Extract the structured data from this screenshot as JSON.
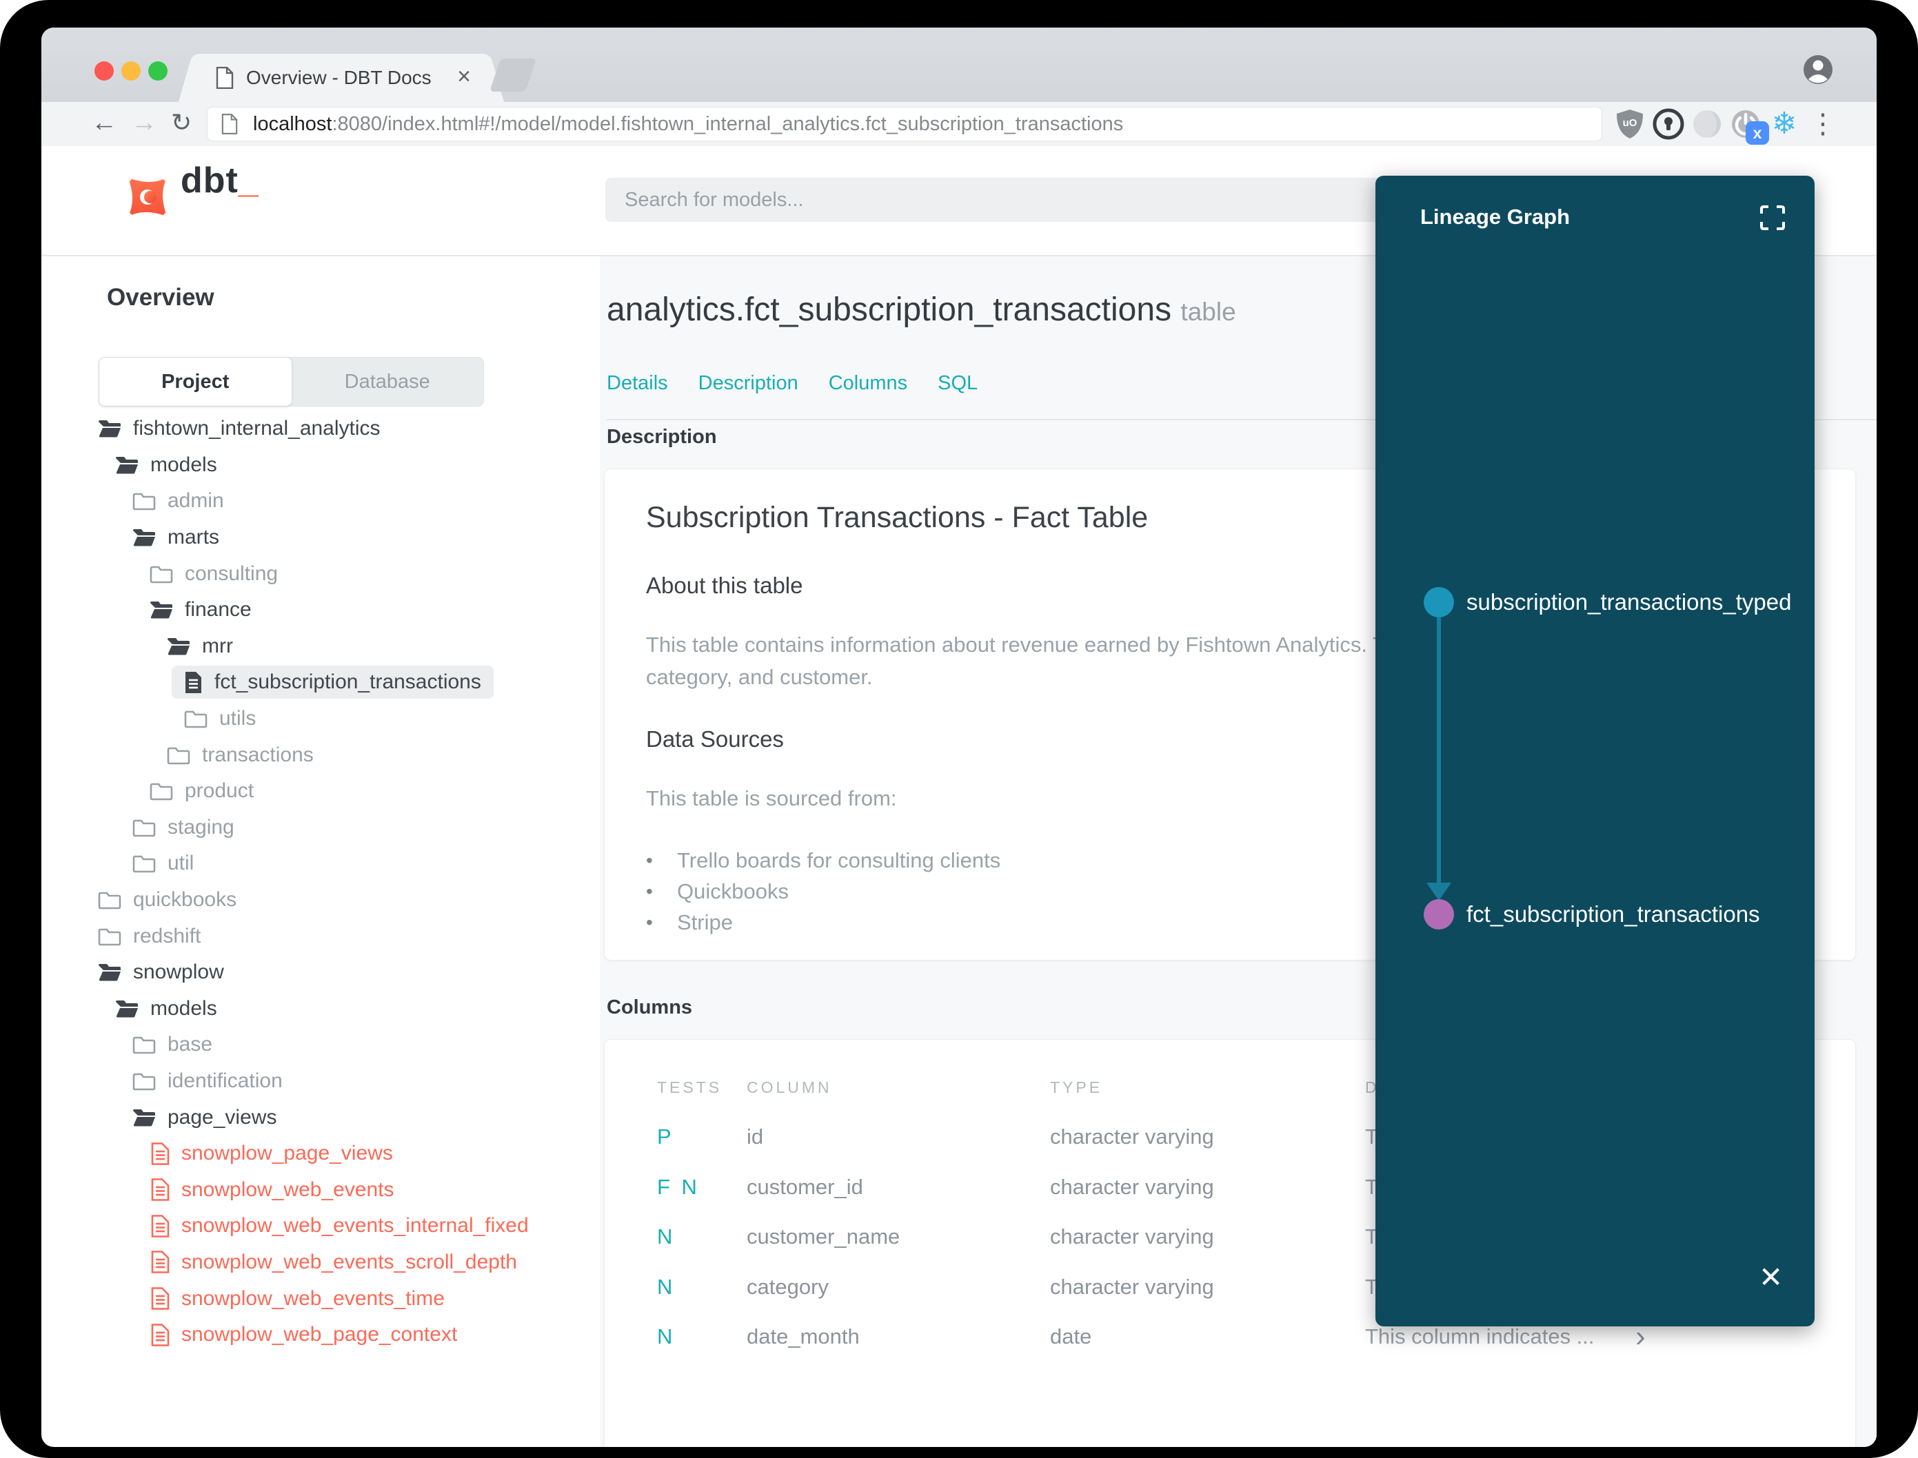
{
  "browser": {
    "tab_title": "Overview - DBT Docs",
    "tab_close": "×",
    "url_host": "localhost",
    "url_rest": ":8080/index.html#!/model/model.fishtown_internal_analytics.fct_subscription_transactions",
    "back": "←",
    "forward": "→",
    "reload": "↻",
    "snowflake": "❄",
    "menu_dots": "⋮",
    "shield_text": "uO",
    "badge_x": "x"
  },
  "header": {
    "logo_text": "dbt",
    "logo_underscore": "_",
    "search_placeholder": "Search for models..."
  },
  "sidebar": {
    "section_title": "Overview",
    "tabs": {
      "project": "Project",
      "database": "Database"
    },
    "tree": [
      {
        "label": "fishtown_internal_analytics",
        "icon": "folder-open",
        "tone": "dark",
        "indent": 64,
        "selected": false
      },
      {
        "label": "models",
        "icon": "folder-open",
        "tone": "dark",
        "indent": 89,
        "selected": false
      },
      {
        "label": "admin",
        "icon": "folder-closed",
        "tone": "muted",
        "indent": 114,
        "selected": false
      },
      {
        "label": "marts",
        "icon": "folder-open",
        "tone": "dark",
        "indent": 114,
        "selected": false
      },
      {
        "label": "consulting",
        "icon": "folder-closed",
        "tone": "muted",
        "indent": 139,
        "selected": false
      },
      {
        "label": "finance",
        "icon": "folder-open",
        "tone": "dark",
        "indent": 139,
        "selected": false
      },
      {
        "label": "mrr",
        "icon": "folder-open",
        "tone": "dark",
        "indent": 164,
        "selected": false
      },
      {
        "label": "fct_subscription_transactions",
        "icon": "file",
        "tone": "dark",
        "indent": 189,
        "selected": true
      },
      {
        "label": "utils",
        "icon": "folder-closed",
        "tone": "muted",
        "indent": 189,
        "selected": false
      },
      {
        "label": "transactions",
        "icon": "folder-closed",
        "tone": "muted",
        "indent": 164,
        "selected": false
      },
      {
        "label": "product",
        "icon": "folder-closed",
        "tone": "muted",
        "indent": 139,
        "selected": false
      },
      {
        "label": "staging",
        "icon": "folder-closed",
        "tone": "muted",
        "indent": 114,
        "selected": false
      },
      {
        "label": "util",
        "icon": "folder-closed",
        "tone": "muted",
        "indent": 114,
        "selected": false
      },
      {
        "label": "quickbooks",
        "icon": "folder-closed",
        "tone": "muted",
        "indent": 64,
        "selected": false
      },
      {
        "label": "redshift",
        "icon": "folder-closed",
        "tone": "muted",
        "indent": 64,
        "selected": false
      },
      {
        "label": "snowplow",
        "icon": "folder-open",
        "tone": "dark",
        "indent": 64,
        "selected": false
      },
      {
        "label": "models",
        "icon": "folder-open",
        "tone": "dark",
        "indent": 89,
        "selected": false
      },
      {
        "label": "base",
        "icon": "folder-closed",
        "tone": "muted",
        "indent": 114,
        "selected": false
      },
      {
        "label": "identification",
        "icon": "folder-closed",
        "tone": "muted",
        "indent": 114,
        "selected": false
      },
      {
        "label": "page_views",
        "icon": "folder-open",
        "tone": "dark",
        "indent": 114,
        "selected": false
      },
      {
        "label": "snowplow_page_views",
        "icon": "file",
        "tone": "red",
        "indent": 141,
        "selected": false
      },
      {
        "label": "snowplow_web_events",
        "icon": "file",
        "tone": "red",
        "indent": 141,
        "selected": false
      },
      {
        "label": "snowplow_web_events_internal_fixed",
        "icon": "file",
        "tone": "red",
        "indent": 141,
        "selected": false
      },
      {
        "label": "snowplow_web_events_scroll_depth",
        "icon": "file",
        "tone": "red",
        "indent": 141,
        "selected": false
      },
      {
        "label": "snowplow_web_events_time",
        "icon": "file",
        "tone": "red",
        "indent": 141,
        "selected": false
      },
      {
        "label": "snowplow_web_page_context",
        "icon": "file",
        "tone": "red",
        "indent": 141,
        "selected": false
      }
    ]
  },
  "main": {
    "title": "analytics.fct_subscription_transactions",
    "title_suffix": "table",
    "nav": [
      "Details",
      "Description",
      "Columns",
      "SQL"
    ],
    "description_section": {
      "heading": "Description",
      "doc_title": "Subscription Transactions - Fact Table",
      "about_heading": "About this table",
      "about_lines": [
        "This table contains information about revenue earned by Fishtown Analytics. Transactions are grouped by month,",
        "category, and customer."
      ],
      "sources_heading": "Data Sources",
      "sources_intro": "This table is sourced from:",
      "sources": [
        "Trello boards for consulting clients",
        "Quickbooks",
        "Stripe"
      ],
      "bullet": "•"
    },
    "columns_section": {
      "heading": "Columns",
      "table": {
        "headers": [
          "TESTS",
          "COLUMN",
          "TYPE",
          "DESCRIPTION"
        ],
        "rows": [
          {
            "tests": "P",
            "column": "id",
            "type": "character varying",
            "description": "The",
            "chevron": "›"
          },
          {
            "tests": "F N",
            "column": "customer_id",
            "type": "character varying",
            "description": "The",
            "chevron": "›"
          },
          {
            "tests": "N",
            "column": "customer_name",
            "type": "character varying",
            "description": "The",
            "chevron": "›"
          },
          {
            "tests": "N",
            "column": "category",
            "type": "character varying",
            "description": "The",
            "chevron": "›"
          },
          {
            "tests": "N",
            "column": "date_month",
            "type": "date",
            "description": "This column indicates ...",
            "chevron": "›"
          }
        ]
      }
    }
  },
  "lineage": {
    "title": "Lineage Graph",
    "close": "✕",
    "nodes": [
      {
        "label": "subscription_transactions_typed",
        "color": "#1b95ba"
      },
      {
        "label": "fct_subscription_transactions",
        "color": "#b16cb5"
      }
    ]
  },
  "colors": {
    "accent_teal": "#18aeb5",
    "accent_red": "#fb6a57",
    "panel_bg": "#0d4a5e",
    "node_blue": "#1b95ba",
    "node_purple": "#b16cb5",
    "traffic_red": "#fc5753",
    "traffic_yellow": "#fdbc40",
    "traffic_green": "#33c748",
    "logo_orange": "#ff5c35"
  }
}
